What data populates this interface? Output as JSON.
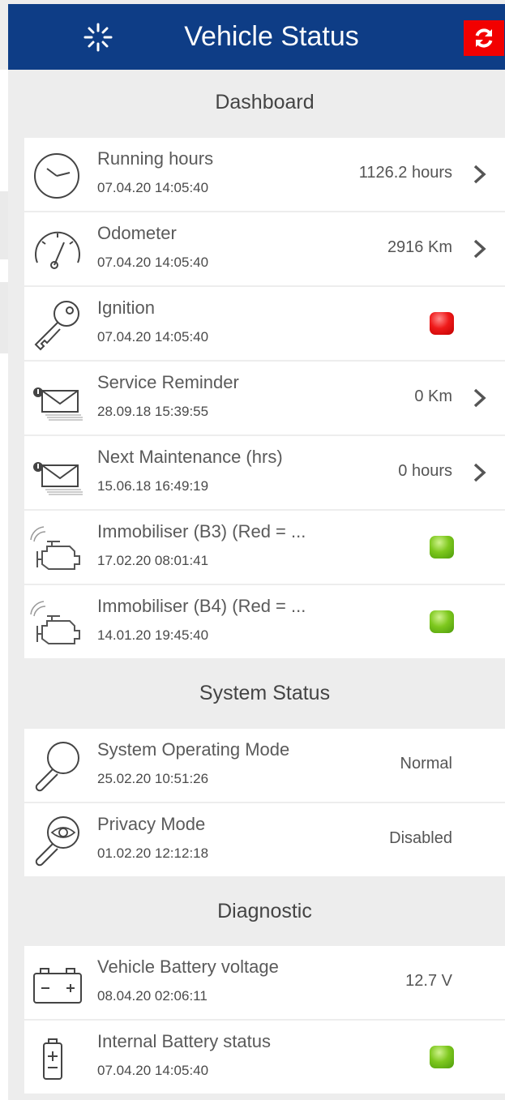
{
  "header": {
    "title": "Vehicle Status",
    "refresh_icon": "refresh-icon",
    "loading_icon": "spinner-icon"
  },
  "dashboard": {
    "title": "Dashboard",
    "rows": [
      {
        "label": "Running hours",
        "time": "07.04.20 14:05:40",
        "value": "1126.2 hours",
        "icon": "clock-icon"
      },
      {
        "label": "Odometer",
        "time": "07.04.20 14:05:40",
        "value": "2916 Km",
        "icon": "speedometer-icon"
      },
      {
        "label": "Ignition",
        "time": "07.04.20 14:05:40",
        "status": "red",
        "icon": "key-icon"
      },
      {
        "label": "Service Reminder",
        "time": "28.09.18 15:39:55",
        "value": "0 Km",
        "icon": "envelope-alert-icon"
      },
      {
        "label": "Next Maintenance (hrs)",
        "time": "15.06.18 16:49:19",
        "value": "0 hours",
        "icon": "envelope-alert-icon"
      },
      {
        "label": "Immobiliser (B3) (Red = ...",
        "time": "17.02.20 08:01:41",
        "status": "green",
        "icon": "engine-icon"
      },
      {
        "label": "Immobiliser (B4) (Red = ...",
        "time": "14.01.20 19:45:40",
        "status": "green",
        "icon": "engine-icon"
      }
    ]
  },
  "system": {
    "title": "System Status",
    "rows": [
      {
        "label": "System Operating Mode",
        "time": "25.02.20 10:51:26",
        "value": "Normal",
        "icon": "magnifier-icon"
      },
      {
        "label": "Privacy Mode",
        "time": "01.02.20 12:12:18",
        "value": "Disabled",
        "icon": "eye-magnifier-icon"
      }
    ]
  },
  "diagnostic": {
    "title": "Diagnostic",
    "rows": [
      {
        "label": "Vehicle Battery voltage",
        "time": "08.04.20 02:06:11",
        "value": "12.7 V",
        "icon": "car-battery-icon"
      },
      {
        "label": "Internal Battery status",
        "time": "07.04.20 14:05:40",
        "status": "green",
        "icon": "battery-icon"
      }
    ]
  },
  "colors": {
    "header": "#0e3d86",
    "refresh": "#f20000",
    "led_red": "#ef1a1a",
    "led_green": "#7ec81e"
  }
}
